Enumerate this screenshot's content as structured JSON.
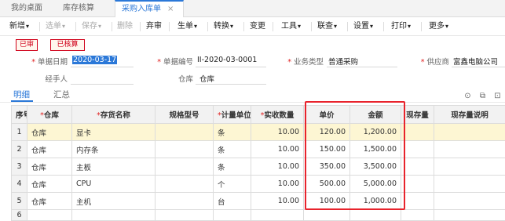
{
  "tabs": [
    {
      "label": "我的桌面"
    },
    {
      "label": "库存核算"
    },
    {
      "label": "采购入库单",
      "close": "×"
    }
  ],
  "toolbar": {
    "add": "新增",
    "select": "选单",
    "save": "保存",
    "delete": "删除",
    "abandon": "弃审",
    "generate": "生单",
    "convert": "转换",
    "change": "变更",
    "tools": "工具",
    "linked": "联查",
    "settings": "设置",
    "print": "打印",
    "more": "更多",
    "caret": "▾"
  },
  "stamps": {
    "audited": "已审",
    "accounted": "已核算"
  },
  "form": {
    "req": "*",
    "date_label": "单据日期",
    "date_value": "2020-03-17",
    "number_label": "单据编号",
    "number_value": "II-2020-03-0001",
    "biztype_label": "业务类型",
    "biztype_value": "普通采购",
    "supplier_label": "供应商",
    "supplier_value": "富鑫电脑公司",
    "handler_label": "经手人",
    "warehouse_label": "仓库",
    "warehouse_value": "仓库"
  },
  "subtabs": {
    "detail": "明细",
    "summary": "汇总"
  },
  "icons": {
    "location": "⊙",
    "copy": "⧉",
    "camera": "⊡"
  },
  "table": {
    "headers": {
      "seq": "序号",
      "warehouse": "仓库",
      "item": "存货名称",
      "spec": "规格型号",
      "unit": "计量单位",
      "qty": "实收数量",
      "price": "单价",
      "amount": "金额",
      "stock": "现存量",
      "stock_note": "现存量说明"
    },
    "rows": [
      {
        "seq": "1",
        "warehouse": "仓库",
        "item": "显卡",
        "spec": "",
        "unit": "条",
        "qty": "10.00",
        "price": "120.00",
        "amount": "1,200.00"
      },
      {
        "seq": "2",
        "warehouse": "仓库",
        "item": "内存条",
        "spec": "",
        "unit": "条",
        "qty": "10.00",
        "price": "150.00",
        "amount": "1,500.00"
      },
      {
        "seq": "3",
        "warehouse": "仓库",
        "item": "主板",
        "spec": "",
        "unit": "条",
        "qty": "10.00",
        "price": "350.00",
        "amount": "3,500.00"
      },
      {
        "seq": "4",
        "warehouse": "仓库",
        "item": "CPU",
        "spec": "",
        "unit": "个",
        "qty": "10.00",
        "price": "500.00",
        "amount": "5,000.00"
      },
      {
        "seq": "5",
        "warehouse": "仓库",
        "item": "主机",
        "spec": "",
        "unit": "台",
        "qty": "10.00",
        "price": "100.00",
        "amount": "1,000.00"
      },
      {
        "seq": "6",
        "warehouse": "",
        "item": "",
        "spec": "",
        "unit": "",
        "qty": "",
        "price": "",
        "amount": ""
      }
    ]
  },
  "colors": {
    "accent": "#2b78d8",
    "highlight_box": "#e8232c",
    "stamp": "#d0021b",
    "row_highlight": "#fdf6d3"
  }
}
